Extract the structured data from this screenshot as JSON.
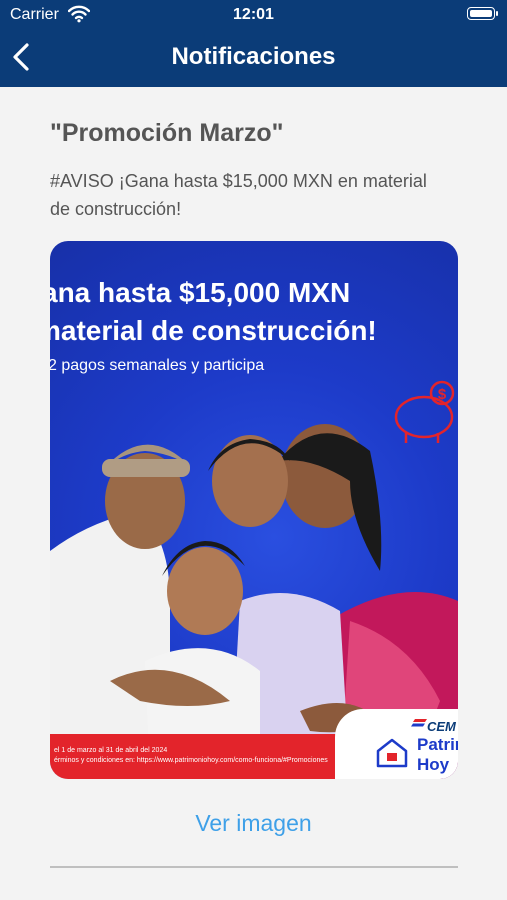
{
  "status_bar": {
    "carrier": "Carrier",
    "time": "12:01"
  },
  "nav": {
    "title": "Notificaciones",
    "back_icon": "chevron-left-icon"
  },
  "notification": {
    "title": "\"Promoción Marzo\"",
    "body": "#AVISO ¡Gana hasta $15,000 MXN en material de construcción!"
  },
  "promo_image": {
    "line1": "ana hasta $15,000 MXN",
    "line2": "material de construcción!",
    "line3": "2 pagos semanales y participa",
    "legal1": "el 1 de marzo al 31 de abril del 2024",
    "legal2": "érminos y condiciones en: https://www.patrimoniohoy.com/como-funciona/#Promociones",
    "brand_top": "CEM",
    "brand_line1": "Patrim",
    "brand_line2": "Hoy",
    "colors": {
      "background": "#1d3bc9",
      "band": "#e3242b",
      "brand": "#1d3bc9"
    }
  },
  "actions": {
    "view_image": "Ver imagen"
  },
  "colors": {
    "header": "#0b3c78",
    "link": "#3ea0e8",
    "text": "#555555"
  }
}
